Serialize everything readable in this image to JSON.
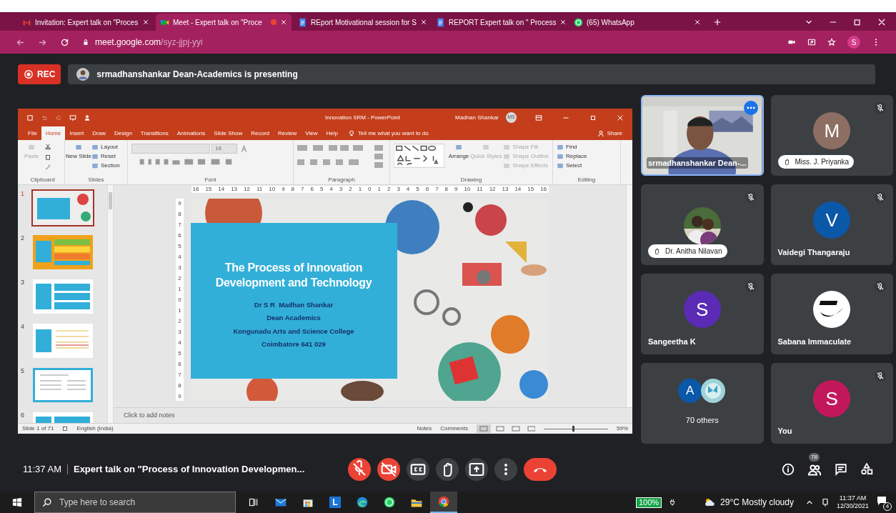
{
  "browser": {
    "tabs": [
      {
        "title": "Invitation: Expert talk on \"Proces",
        "selected": false,
        "recording": false
      },
      {
        "title": "Meet - Expert talk on \"Proce",
        "selected": true,
        "recording": true
      },
      {
        "title": "REport Motivational session for S",
        "selected": false,
        "recording": false
      },
      {
        "title": "REPORT Expert talk on \" Process",
        "selected": false,
        "recording": false
      },
      {
        "title": "(65) WhatsApp",
        "selected": false,
        "recording": false
      }
    ],
    "url_host": "meet.google.com",
    "url_path": "/syz-jjpj-yyi",
    "profile": "S"
  },
  "recording": {
    "label": "REC"
  },
  "presenter_banner": "srmadhanshankar Dean-Academics is presenting",
  "powerpoint": {
    "title": "Innovation SRM  -  PowerPoint",
    "user": "Madhan Shankar",
    "initials": "MS",
    "menu": [
      {
        "label": "File",
        "selected": false
      },
      {
        "label": "Home",
        "selected": true
      },
      {
        "label": "Insert",
        "selected": false
      },
      {
        "label": "Draw",
        "selected": false
      },
      {
        "label": "Design",
        "selected": false
      },
      {
        "label": "Transitions",
        "selected": false
      },
      {
        "label": "Animations",
        "selected": false
      },
      {
        "label": "Slide Show",
        "selected": false
      },
      {
        "label": "Record",
        "selected": false
      },
      {
        "label": "Review",
        "selected": false
      },
      {
        "label": "View",
        "selected": false
      },
      {
        "label": "Help",
        "selected": false
      }
    ],
    "tell_me": "Tell me what you want to do",
    "share": "Share",
    "ribbon": [
      {
        "kind": "clipboard",
        "label": "Clipboard",
        "items": [
          {
            "label": "Paste",
            "disabled": true
          }
        ]
      },
      {
        "kind": "slides",
        "label": "Slides",
        "items": [
          {
            "label": "New Slide",
            "disabled": false
          },
          {
            "label": "Layout",
            "disabled": false
          },
          {
            "label": "Reset",
            "disabled": false
          },
          {
            "label": "Section",
            "disabled": false
          }
        ]
      },
      {
        "kind": "font",
        "label": "Font",
        "items": [
          {
            "label": "16",
            "disabled": true
          }
        ]
      },
      {
        "kind": "paragraph",
        "label": "Paragraph"
      },
      {
        "kind": "drawing",
        "label": "Drawing",
        "items": [
          {
            "label": "Arrange",
            "disabled": false
          },
          {
            "label": "Quick Styles",
            "disabled": true
          },
          {
            "label": "Shape Fill",
            "disabled": true
          },
          {
            "label": "Shape Outline",
            "disabled": true
          },
          {
            "label": "Shape Effects",
            "disabled": true
          }
        ]
      },
      {
        "kind": "editing",
        "label": "Editing",
        "items": [
          {
            "label": "Find",
            "disabled": false
          },
          {
            "label": "Replace",
            "disabled": false
          },
          {
            "label": "Select",
            "disabled": false
          }
        ]
      }
    ],
    "thumbnails": [
      {
        "number": "1",
        "kind": "title",
        "selected": true
      },
      {
        "number": "2",
        "kind": "orange",
        "selected": false
      },
      {
        "number": "3",
        "kind": "teal",
        "selected": false
      },
      {
        "number": "4",
        "kind": "bullets",
        "selected": false
      },
      {
        "number": "5",
        "kind": "table",
        "selected": false
      },
      {
        "number": "6",
        "kind": "teal",
        "selected": false
      }
    ],
    "ruler": [
      "16",
      "15",
      "14",
      "13",
      "12",
      "11",
      "10",
      "9",
      "8",
      "7",
      "6",
      "5",
      "4",
      "3",
      "2",
      "1",
      "0",
      "1",
      "2",
      "3",
      "4",
      "5",
      "6",
      "7",
      "8",
      "9",
      "10",
      "11",
      "12",
      "13",
      "14",
      "15",
      "16"
    ],
    "vertical_ruler": [
      "9",
      "8",
      "7",
      "6",
      "5",
      "4",
      "3",
      "2",
      "1",
      "0",
      "1",
      "2",
      "3",
      "4",
      "5",
      "6",
      "7",
      "8",
      "9"
    ],
    "slide": {
      "title": "The Process of Innovation Development and Technology",
      "lines": [
        "Dr S R  Madhan Shankar",
        "Dean Academics",
        "Kongunadu Arts and Science College",
        "Coimbatore 641 029"
      ]
    },
    "notes": "Click to add notes",
    "status": {
      "slide_info": "Slide 1 of 71",
      "language": "English (India)",
      "notes": "Notes",
      "comments": "Comments",
      "zoom": "59%",
      "level": 0.45
    }
  },
  "tiles": [
    {
      "name": "srmadhanshankar Dean-...",
      "kind": "video",
      "speaking": true,
      "muted": false,
      "hand_raised": false
    },
    {
      "name": "Miss. J. Priyanka",
      "kind": "initial",
      "initial": "M",
      "color": "#8d6e63",
      "speaking": false,
      "muted": true,
      "hand_raised": true
    },
    {
      "name": "Dr. Anitha Nilavan",
      "speaking": false,
      "muted": true,
      "hand_raised": true
    },
    {
      "name": "Vaidegi Thangaraju",
      "kind": "initial",
      "initial": "V",
      "color": "#0b57a8",
      "speaking": false,
      "muted": true,
      "hand_raised": false
    },
    {
      "name": "Sangeetha K",
      "kind": "initial",
      "initial": "S",
      "color": "#5b2bb5",
      "speaking": false,
      "muted": true,
      "hand_raised": false
    },
    {
      "name": "Sabana Immaculate",
      "kind": "logo",
      "speaking": false,
      "muted": true,
      "hand_raised": false
    },
    {
      "name": "70 others",
      "kind": "group",
      "initial": "A",
      "color": "#0b57a8",
      "speaking": false,
      "muted": false,
      "hand_raised": false
    },
    {
      "name": "You",
      "kind": "initial",
      "initial": "S",
      "color": "#c2185b",
      "speaking": false,
      "muted": true,
      "hand_raised": false
    }
  ],
  "bottom_bar": {
    "time": "11:37 AM",
    "meeting_title": "Expert talk on \"Process of Innovation Developmen...",
    "controls": [
      {
        "kind": "mic",
        "off": true
      },
      {
        "kind": "camera",
        "off": true
      },
      {
        "kind": "captions",
        "off": false
      },
      {
        "kind": "hand",
        "off": false
      },
      {
        "kind": "present",
        "off": false
      },
      {
        "kind": "more",
        "off": false
      },
      {
        "kind": "end"
      }
    ],
    "participants_count": "78"
  },
  "taskbar": {
    "search_placeholder": "Type here to search",
    "apps": [
      {
        "kind": "taskview",
        "selected": false
      },
      {
        "kind": "mail",
        "selected": false
      },
      {
        "kind": "store",
        "selected": false
      },
      {
        "kind": "launcher",
        "label": "L",
        "selected": false
      },
      {
        "kind": "edge",
        "selected": false
      },
      {
        "kind": "whatsapp",
        "selected": false
      },
      {
        "kind": "files",
        "selected": false
      },
      {
        "kind": "chrome",
        "selected": true
      }
    ],
    "battery": "100%",
    "weather": "29°C Mostly cloudy",
    "time": "11:37 AM",
    "date": "12/30/2021",
    "notifications": "4"
  }
}
